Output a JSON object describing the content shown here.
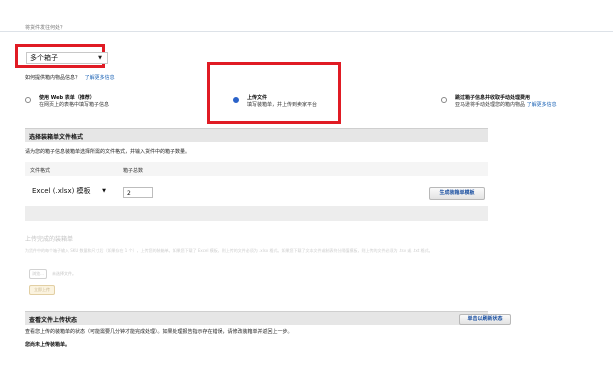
{
  "header": {
    "cut_text": "将货件发往何处？"
  },
  "shipping": {
    "select_value": "多个箱子",
    "question": "如何提供箱内物品信息？",
    "learn_more": "了解更多信息"
  },
  "options": [
    {
      "title": "使用 Web 表单（推荐）",
      "desc": "在网页上的表格中填写箱子信息",
      "selected": false
    },
    {
      "title": "上传文件",
      "desc": "填写装箱单，并上传到卖家平台",
      "selected": true
    },
    {
      "title": "跳过箱子信息并收取手动处理费用",
      "desc": "亚马逊将手动处理您的箱内物品",
      "link": "了解更多信息",
      "selected": false
    }
  ],
  "format_panel": {
    "title": "选择装箱单文件格式",
    "note": "请为您的箱子信息装箱单选择所需的文件格式，并输入货件中的箱子数量。",
    "col_format": "文件格式",
    "col_boxes": "箱子总数",
    "format_value": "Excel (.xlsx) 模板",
    "box_count": "2",
    "generate_button": "生成装箱单模板"
  },
  "upload_panel": {
    "title": "上传完成的装箱单",
    "note": "为货件中的每个箱子输入 SKU 数量和尺寸后（如果存在 1 个），上传您的装箱单。如果您下载了 Excel 模板，则上传的文件必须为 .xlsx 格式。如果您下载了文本文件或制表符分隔值模板，则上传的文件必须为 .tsv 或 .txt 格式。",
    "browse_label": "浏览...",
    "no_file": "未选择文件。",
    "upload_button": "立即上传"
  },
  "status_panel": {
    "title": "查看文件上传状态",
    "refresh_button": "单击以刷新状态",
    "note": "查看您上传的装箱单的状态（可能需要几分钟才能完成处理）。如果处理报告指示存在错误，请修改装箱单并返回上一步。",
    "no_upload": "您尚未上传装箱单。"
  }
}
